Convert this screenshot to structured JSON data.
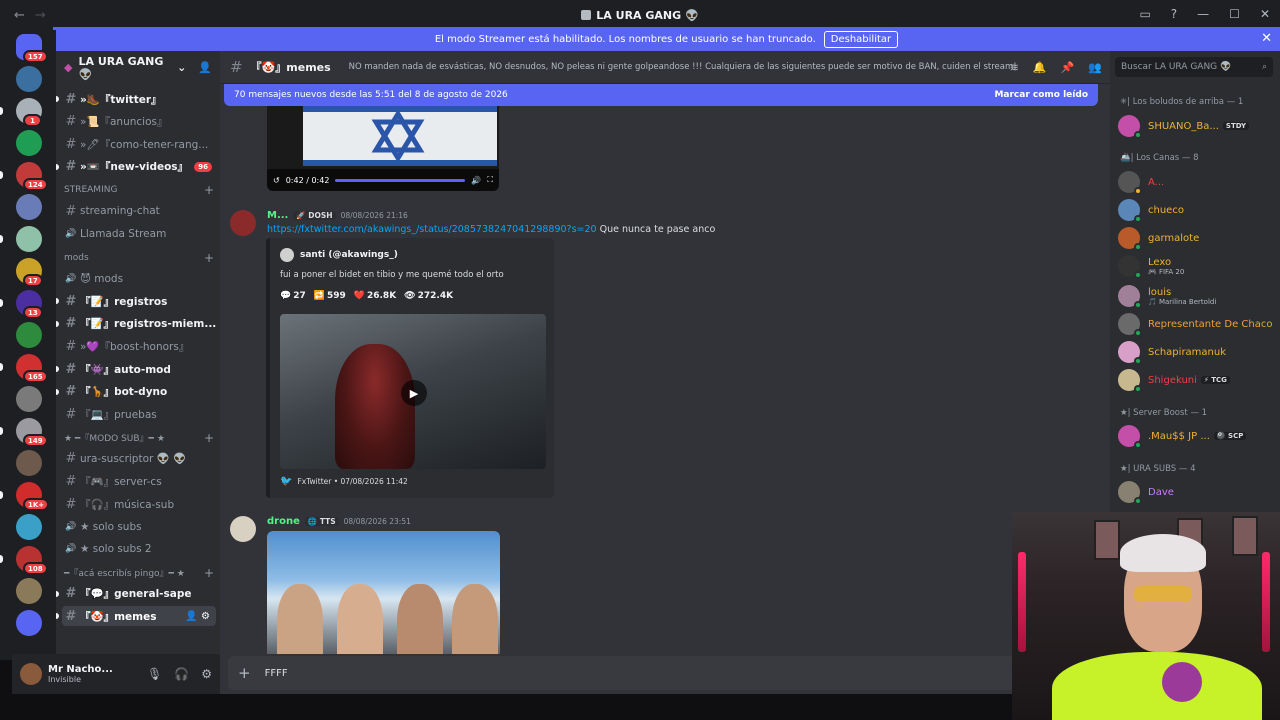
{
  "titlebar": {
    "title": "LA URA GANG 👽"
  },
  "streamer_banner": {
    "text": "El modo Streamer está habilitado. Los nombres de usuario se han truncado.",
    "button": "Deshabilitar"
  },
  "servers": [
    {
      "color": "#5865f2",
      "badge": "157"
    },
    {
      "color": "#3b6fa0",
      "badge": ""
    },
    {
      "color": "#a8b0b8",
      "badge": "1"
    },
    {
      "color": "#1f9d55",
      "badge": ""
    },
    {
      "color": "#c23b3b",
      "badge": "124"
    },
    {
      "color": "#6a7cb8",
      "badge": ""
    },
    {
      "color": "#8fc1a8",
      "badge": ""
    },
    {
      "color": "#c9a227",
      "badge": "17"
    },
    {
      "color": "#4b2fa0",
      "badge": "13"
    },
    {
      "color": "#2e8b3e",
      "badge": ""
    },
    {
      "color": "#d03030",
      "badge": "165"
    },
    {
      "color": "#7a7a7a",
      "badge": ""
    },
    {
      "color": "#9a9aa0",
      "badge": "149"
    },
    {
      "color": "#6d5a4c",
      "badge": ""
    },
    {
      "color": "#d12c2c",
      "badge": "1K+"
    },
    {
      "color": "#3aa0c8",
      "badge": ""
    },
    {
      "color": "#b83232",
      "badge": "108"
    },
    {
      "color": "#8a7a5a",
      "badge": ""
    },
    {
      "color": "#5865f2",
      "badge": ""
    }
  ],
  "guild": {
    "name": "LA URA GANG 👽"
  },
  "channels": [
    {
      "type": "text",
      "label": "»🥾『twitter』",
      "bold": true,
      "badge": ""
    },
    {
      "type": "text",
      "label": "»📜『anuncios』",
      "bold": false,
      "badge": ""
    },
    {
      "type": "text",
      "label": "»🖊『como-tener-rang...",
      "bold": false,
      "badge": ""
    },
    {
      "type": "text",
      "label": "»📼『new-videos』",
      "bold": true,
      "badge": "96"
    },
    {
      "type": "category",
      "label": "STREAMING"
    },
    {
      "type": "text",
      "label": "streaming-chat",
      "bold": false,
      "badge": ""
    },
    {
      "type": "voice",
      "label": "Llamada Stream",
      "bold": false,
      "badge": ""
    },
    {
      "type": "category",
      "label": "mods"
    },
    {
      "type": "voice",
      "label": "😈 mods",
      "bold": false,
      "badge": ""
    },
    {
      "type": "text",
      "label": "『📝』registros",
      "bold": true,
      "badge": ""
    },
    {
      "type": "text",
      "label": "『📝』registros-miem...",
      "bold": true,
      "badge": ""
    },
    {
      "type": "text",
      "label": "»💜『boost-honors』",
      "bold": false,
      "badge": ""
    },
    {
      "type": "text",
      "label": "『👾』auto-mod",
      "bold": true,
      "badge": ""
    },
    {
      "type": "text",
      "label": "『🦒』bot-dyno",
      "bold": true,
      "badge": ""
    },
    {
      "type": "text",
      "label": "『💻』pruebas",
      "bold": false,
      "badge": ""
    },
    {
      "type": "category",
      "label": "★ ━『MODO SUB』━ ★"
    },
    {
      "type": "text",
      "label": "ura-suscriptor 👽 👽",
      "bold": false,
      "badge": ""
    },
    {
      "type": "text",
      "label": "『🎮』server-cs",
      "bold": false,
      "badge": ""
    },
    {
      "type": "text",
      "label": "『🎧』música-sub",
      "bold": false,
      "badge": ""
    },
    {
      "type": "voice",
      "label": "★ solo subs",
      "bold": false,
      "badge": ""
    },
    {
      "type": "voice",
      "label": "★ solo subs 2",
      "bold": false,
      "badge": ""
    },
    {
      "type": "category",
      "label": "━『acá escribís pingo』━ ★"
    },
    {
      "type": "text",
      "label": "『💬』general-sape",
      "bold": true,
      "badge": ""
    },
    {
      "type": "text",
      "label": "『🤡』memes",
      "bold": true,
      "badge": "",
      "active": true
    }
  ],
  "user_panel": {
    "name": "Mr Nacho...",
    "status": "Invisible"
  },
  "chat_header": {
    "channel": "『🤡』memes",
    "topic": "NO manden nada de esvásticas, NO desnudos, NO peleas ni gente golpeandose !!! Cualquiera de las siguientes puede ser motivo de BAN, cuiden el stream!"
  },
  "new_messages_bar": {
    "text": "70 mensajes nuevos desde las 5:51 del 8 de agosto de 2026",
    "action": "Marcar como leído"
  },
  "video_player": {
    "time": "0:42 / 0:42",
    "progress": 1.0
  },
  "messages": [
    {
      "author": "M...",
      "tag": "🚀 DOSH",
      "time": "08/08/2026 21:16",
      "link": "https://fxtwitter.com/akawings_/status/2085738247041298890?s=20",
      "text": " Que nunca te pase anco",
      "embed": {
        "author": "santi (@akawings_)",
        "description": "fui a poner el bidet en tibio y me quemé todo el orto",
        "stats": [
          {
            "icon": "💬",
            "value": "27"
          },
          {
            "icon": "🔁",
            "value": "599"
          },
          {
            "icon": "❤️",
            "value": "26.8K"
          },
          {
            "icon": "👁",
            "value": "272.4K"
          }
        ],
        "footer": "FxTwitter • 07/08/2026 11:42"
      }
    },
    {
      "author": "drone",
      "tag": "🌐 TTS",
      "time": "08/08/2026 23:51"
    }
  ],
  "composer": {
    "value": "FFFF"
  },
  "members_search": {
    "placeholder": "Buscar LA URA GANG 👽"
  },
  "member_groups": [
    {
      "label": "✳| Los boludos de arriba — 1"
    },
    {
      "label": "🚢| Los Canas — 8"
    },
    {
      "label": "★| Server Boost — 1"
    },
    {
      "label": "★| URA SUBS — 4"
    }
  ],
  "members": [
    {
      "name": "SHUANO_Ba...",
      "color": "#f0b232",
      "sub": "",
      "chip": "STDY",
      "avatar": "#c44fa8",
      "status": "online"
    },
    {
      "name": "A...",
      "color": "#f23f43",
      "sub": "",
      "chip": "",
      "avatar": "#555555",
      "status": "idle"
    },
    {
      "name": "chueco",
      "color": "#f0b232",
      "sub": "",
      "chip": "",
      "avatar": "#5a87b8",
      "status": "online"
    },
    {
      "name": "garmalote",
      "color": "#f0b232",
      "sub": "",
      "chip": "",
      "avatar": "#b85a2a",
      "status": "online"
    },
    {
      "name": "Lexo",
      "color": "#f0b232",
      "sub": "🎮 FIFA 20",
      "chip": "",
      "avatar": "#333333",
      "status": "online"
    },
    {
      "name": "louis",
      "color": "#f0b232",
      "sub": "🎵 Marilina Bertoldi",
      "chip": "",
      "avatar": "#a08098",
      "status": "online"
    },
    {
      "name": "Representante De Chaco",
      "color": "#f0a030",
      "sub": "",
      "chip": "",
      "avatar": "#6a6a6a",
      "status": "online"
    },
    {
      "name": "Schapiramanuk",
      "color": "#f0b232",
      "sub": "",
      "chip": "",
      "avatar": "#d8a0c8",
      "status": "online"
    },
    {
      "name": "Shigekuni",
      "color": "#f23f43",
      "sub": "",
      "chip": "⚡ TCG",
      "avatar": "#c8b890",
      "status": "online"
    },
    {
      "name": ".Mau$$ JP ...",
      "color": "#f0b232",
      "sub": "",
      "chip": "🎱 SCP",
      "avatar": "#c44fa8",
      "status": "online"
    },
    {
      "name": "Dave",
      "color": "#c77dff",
      "sub": "",
      "chip": "",
      "avatar": "#888070",
      "status": "online"
    }
  ]
}
